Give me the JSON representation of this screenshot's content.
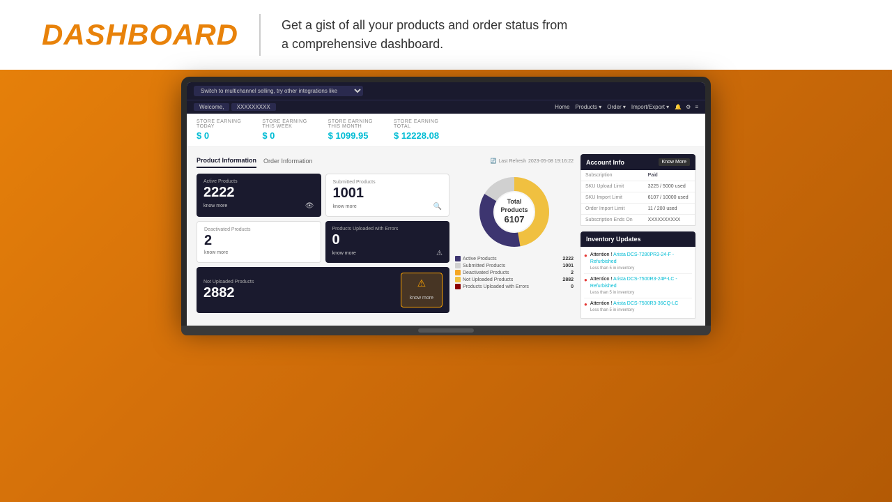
{
  "header": {
    "title": "DASHBOARD",
    "subtitle_line1": "Get a gist of all your products and order status from",
    "subtitle_line2": "a comprehensive dashboard."
  },
  "topbar": {
    "select_placeholder": "Switch to multichannel selling, try other integrations like"
  },
  "nav": {
    "welcome_text": "Welcome,",
    "username": "XXXXXXXXX",
    "links": [
      "Home",
      "Products ▾",
      "Order ▾",
      "Import/Export ▾"
    ],
    "icons": [
      "🔔",
      "⚙",
      "≡"
    ]
  },
  "earnings": [
    {
      "label": "STORE EARNING",
      "sublabel": "TODAY",
      "value": "$ 0"
    },
    {
      "label": "STORE EARNING",
      "sublabel": "THIS WEEK",
      "value": "$ 0"
    },
    {
      "label": "STORE EARNING",
      "sublabel": "THIS MONTH",
      "value": "$ 1099.95"
    },
    {
      "label": "STORE EARNING",
      "sublabel": "TOTAL",
      "value": "$ 12228.08"
    }
  ],
  "tabs": {
    "items": [
      "Product Information",
      "Order Information"
    ],
    "active": 0,
    "last_refresh_label": "Last Refresh",
    "last_refresh_time": "2023-05-08 19:16:22"
  },
  "product_cards": {
    "active": {
      "label": "Active Products",
      "value": "2222",
      "know_more": "know more",
      "icon": "👁"
    },
    "submitted": {
      "label": "Submitted Products",
      "value": "1001",
      "know_more": "know more",
      "icon": "🔍"
    },
    "deactivated": {
      "label": "Deactivated Products",
      "value": "2",
      "know_more": "know more"
    },
    "errors": {
      "label": "Products Uploaded with Errors",
      "value": "0",
      "know_more": "know more",
      "icon": "⚠"
    },
    "not_uploaded": {
      "label": "Not Uploaded Products",
      "value": "2882",
      "know_more": "know more",
      "icon": "⚠"
    }
  },
  "donut_chart": {
    "center_label": "Total Products",
    "center_value": "6107",
    "segments": [
      {
        "label": "Active Products",
        "value": 2222,
        "color": "#3d3570",
        "pct": 36.4
      },
      {
        "label": "Submitted Products",
        "value": 1001,
        "color": "#e0e0e0",
        "pct": 16.4
      },
      {
        "label": "Deactivated Products",
        "value": 2,
        "color": "#f5a623",
        "pct": 0.1
      },
      {
        "label": "Not Uploaded Products",
        "value": 2882,
        "color": "#f0c040",
        "pct": 47.2
      },
      {
        "label": "Products Uploaded with Errors",
        "value": 0,
        "color": "#8b0000",
        "pct": 0
      }
    ]
  },
  "account_info": {
    "title": "Account Info",
    "know_more": "Know More",
    "rows": [
      {
        "label": "Subscription",
        "value": "Paid"
      },
      {
        "label": "SKU Upload Limit",
        "value": "3225 / 5000 used"
      },
      {
        "label": "SKU Import Limit",
        "value": "6107 / 10000 used"
      },
      {
        "label": "Order Import Limit",
        "value": "11 / 200 used"
      },
      {
        "label": "Subscription Ends On",
        "value": "XXXXXXXXXX"
      }
    ]
  },
  "inventory_updates": {
    "title": "Inventory Updates",
    "items": [
      {
        "attention": "Attention !",
        "name": "Arista DCS-7280PR3-24-F - Refurbished",
        "sub": "Less than 5 in inventory"
      },
      {
        "attention": "Attention !",
        "name": "Arista DCS-7500R3-24P-LC - Refurbished",
        "sub": "Less than 5 in inventory"
      },
      {
        "attention": "Attention !",
        "name": "Arista DCS-7500R3-36CQ-LC",
        "sub": "Less than 5 in inventory"
      }
    ]
  },
  "colors": {
    "brand_orange": "#e8820a",
    "dark_navy": "#1a1a2e",
    "teal": "#00bcd4",
    "active_purple": "#3d3570",
    "submitted_gray": "#e0e0e0",
    "deactivated_orange": "#f5a623",
    "not_uploaded_yellow": "#f0c040",
    "errors_red": "#8b0000"
  }
}
